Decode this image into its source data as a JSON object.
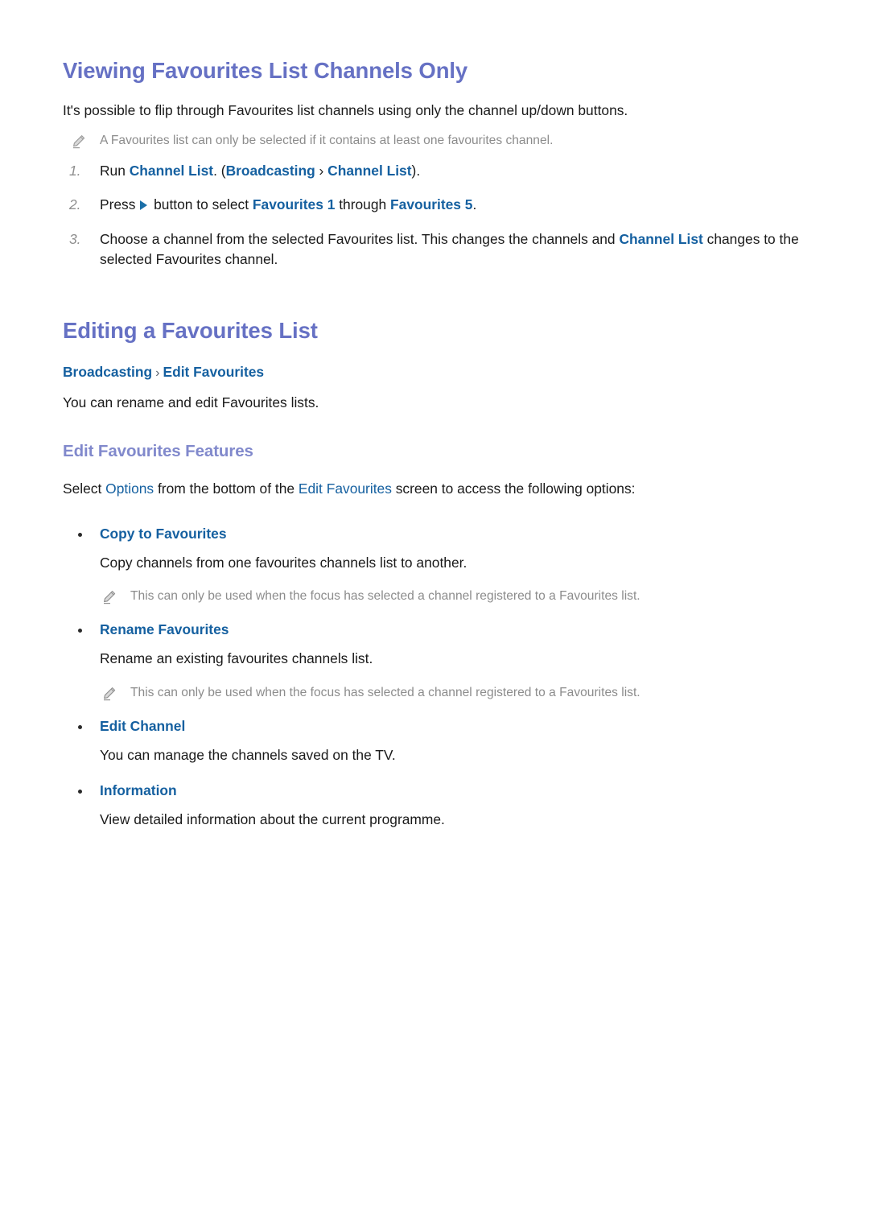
{
  "colors": {
    "h1": "#6671c4",
    "h2": "#8189cc",
    "link": "#1560a0",
    "body": "#1a1a1a",
    "note": "#8c8c8c",
    "marker": "#8e8e8e"
  },
  "section_one": {
    "heading": "Viewing Favourites List Channels Only",
    "intro": "It's possible to flip through Favourites list channels using only the channel up/down buttons.",
    "note": "A Favourites list can only be selected if it contains at least one favourites channel.",
    "note_icon": "pencil-icon",
    "steps": [
      {
        "number": "1.",
        "parts": [
          {
            "text": "Run ",
            "style": "plain"
          },
          {
            "text": "Channel List",
            "style": "link"
          },
          {
            "text": ". (",
            "style": "plain"
          },
          {
            "text": "Broadcasting",
            "style": "link"
          },
          {
            "text": " › ",
            "style": "sep"
          },
          {
            "text": "Channel List",
            "style": "link"
          },
          {
            "text": ").",
            "style": "plain"
          }
        ]
      },
      {
        "number": "2.",
        "parts": [
          {
            "text": "Press ",
            "style": "plain"
          },
          {
            "text": "",
            "style": "triangle"
          },
          {
            "text": " button to select ",
            "style": "plain"
          },
          {
            "text": "Favourites 1",
            "style": "link"
          },
          {
            "text": " through ",
            "style": "plain"
          },
          {
            "text": "Favourites 5",
            "style": "link"
          },
          {
            "text": ".",
            "style": "plain"
          }
        ]
      },
      {
        "number": "3.",
        "parts": [
          {
            "text": "Choose a channel from the selected Favourites list. This changes the channels and ",
            "style": "plain"
          },
          {
            "text": "Channel List",
            "style": "link"
          },
          {
            "text": " changes to the selected Favourites channel.",
            "style": "plain"
          }
        ]
      }
    ]
  },
  "section_two": {
    "heading": "Editing a Favourites List",
    "breadcrumb": {
      "first": "Broadcasting",
      "separator": "›",
      "second": "Edit Favourites"
    },
    "description": "You can rename and edit Favourites lists.",
    "subheading": "Edit Favourites Features",
    "lead": {
      "parts": [
        {
          "text": "Select ",
          "style": "plain"
        },
        {
          "text": "Options",
          "style": "link-plain"
        },
        {
          "text": " from the bottom of the ",
          "style": "plain"
        },
        {
          "text": "Edit Favourites",
          "style": "link-plain"
        },
        {
          "text": " screen to access the following options:",
          "style": "plain"
        }
      ]
    },
    "options": [
      {
        "label": "Copy to Favourites",
        "description": "Copy channels from one favourites channels list to another.",
        "note": "This can only be used when the focus has selected a channel registered to a Favourites list.",
        "note_icon": "pencil-icon"
      },
      {
        "label": "Rename Favourites",
        "description": "Rename an existing favourites channels list.",
        "note": "This can only be used when the focus has selected a channel registered to a Favourites list.",
        "note_icon": "pencil-icon"
      },
      {
        "label": "Edit Channel",
        "description": "You can manage the channels saved on the TV.",
        "note": null,
        "note_icon": null
      },
      {
        "label": "Information",
        "description": "View detailed information about the current programme.",
        "note": null,
        "note_icon": null
      }
    ]
  }
}
